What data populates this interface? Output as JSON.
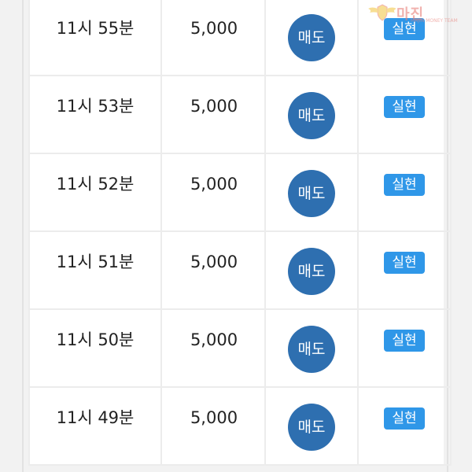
{
  "rows": [
    {
      "time": "11시 55분",
      "amount": "5,000",
      "action": "매도",
      "status": "실현"
    },
    {
      "time": "11시 53분",
      "amount": "5,000",
      "action": "매도",
      "status": "실현"
    },
    {
      "time": "11시 52분",
      "amount": "5,000",
      "action": "매도",
      "status": "실현"
    },
    {
      "time": "11시 51분",
      "amount": "5,000",
      "action": "매도",
      "status": "실현"
    },
    {
      "time": "11시 50분",
      "amount": "5,000",
      "action": "매도",
      "status": "실현"
    },
    {
      "time": "11시 49분",
      "amount": "5,000",
      "action": "매도",
      "status": "실현"
    }
  ],
  "watermark": {
    "text": "마진",
    "tagline": "MAJIN MONEY TEAM"
  },
  "colors": {
    "sell_button": "#2e6fb0",
    "status_badge": "#2f97e8",
    "watermark": "#e8807a"
  },
  "icons": {
    "watermark_emblem": "winged-shield-icon"
  }
}
